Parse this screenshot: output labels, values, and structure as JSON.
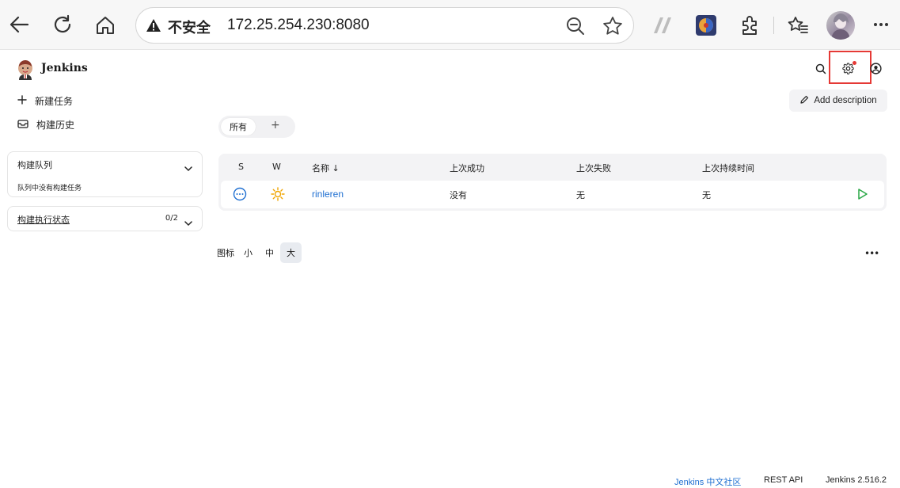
{
  "browser": {
    "security_label": "不安全",
    "url": "172.25.254.230:8080"
  },
  "header": {
    "brand": "Jenkins"
  },
  "sidebar": {
    "items": [
      {
        "label": "新建任务",
        "icon": "plus-icon"
      },
      {
        "label": "构建历史",
        "icon": "history-icon"
      }
    ],
    "queue": {
      "title": "构建队列",
      "empty_text": "队列中没有构建任务"
    },
    "executors": {
      "title": "构建执行状态",
      "count": "0/2"
    }
  },
  "main": {
    "add_description": "Add description",
    "tabs": [
      {
        "label": "所有"
      }
    ],
    "tab_add": "+",
    "table": {
      "headers": {
        "s": "S",
        "w": "W",
        "name": "名称 ↓",
        "last_success": "上次成功",
        "last_failure": "上次失败",
        "last_duration": "上次持续时间"
      },
      "rows": [
        {
          "name": "rinleren",
          "last_success": "没有",
          "last_failure": "无",
          "last_duration": "无",
          "status": "not-built",
          "weather": "sunny"
        }
      ]
    },
    "icon_size": {
      "label": "图标",
      "options": [
        "小",
        "中",
        "大"
      ],
      "selected": "大"
    },
    "more": "•••"
  },
  "footer": {
    "community": "Jenkins 中文社区",
    "rest_api": "REST API",
    "version": "Jenkins 2.516.2"
  },
  "colors": {
    "accent": "#1f6fd1",
    "highlight": "#e53935",
    "run": "#28a745",
    "weather": "#f0a500"
  }
}
